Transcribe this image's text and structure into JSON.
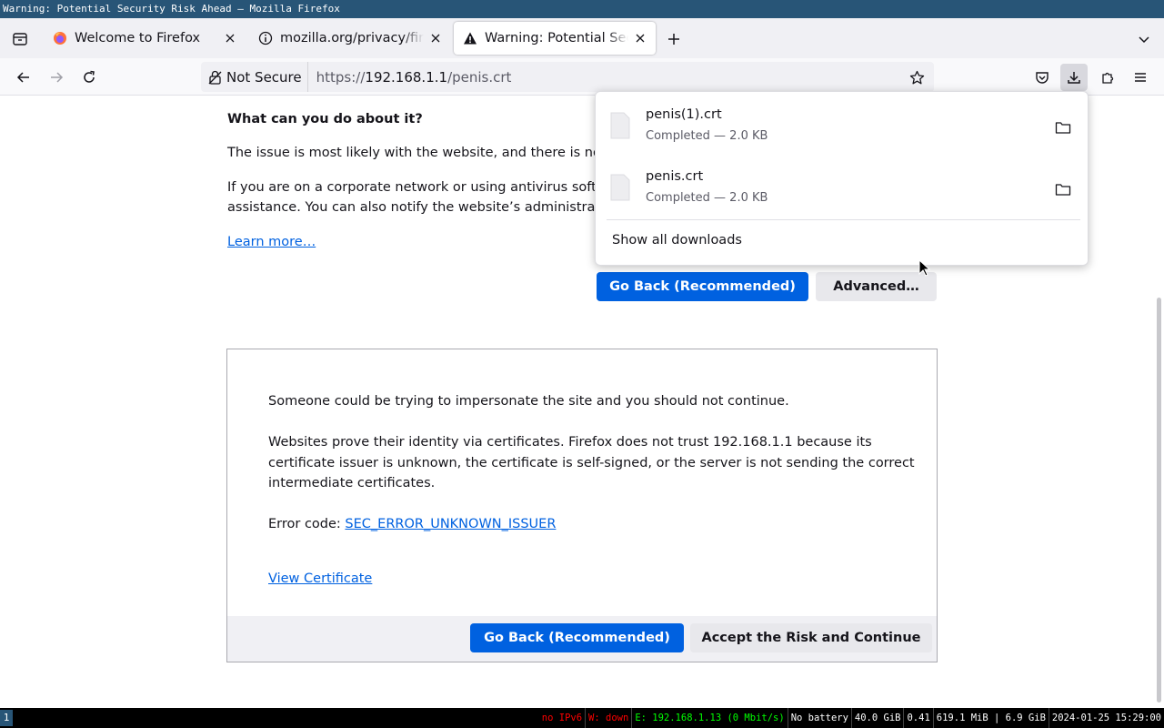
{
  "window": {
    "title": "Warning: Potential Security Risk Ahead — Mozilla Firefox"
  },
  "tabs": [
    {
      "label": "Welcome to Firefox",
      "icon": "firefox-logo-icon"
    },
    {
      "label": "mozilla.org/privacy/firefox",
      "icon": "info-icon"
    },
    {
      "label": "Warning: Potential Security Risk Ahead",
      "icon": "warning-icon",
      "selected": true
    }
  ],
  "navbar": {
    "identity_label": "Not Secure",
    "url_prefix": "https://",
    "url_host": "192.168.1.1",
    "url_path": "/penis.crt"
  },
  "content": {
    "heading": "What can you do about it?",
    "para1": "The issue is most likely with the website, and there is nothing you can do to resolve it.",
    "para2_line1": "If you are on a corporate network or using antivirus software, you can reach out to the support teams for",
    "para2_line2": "assistance. You can also notify the website’s administrator about the problem.",
    "learn_more": "Learn more…",
    "go_back_label": "Go Back (Recommended)",
    "advanced_label": "Advanced…"
  },
  "advanced": {
    "line1": "Someone could be trying to impersonate the site and you should not continue.",
    "line2a": "Websites prove their identity via certificates. Firefox does not trust 192.168.1.1 because its",
    "line2b": "certificate issuer is unknown, the certificate is self-signed, or the server is not sending the correct",
    "line2c": "intermediate certificates.",
    "error_code_label": "Error code: ",
    "error_code": "SEC_ERROR_UNKNOWN_ISSUER",
    "view_certificate": "View Certificate",
    "go_back_label": "Go Back (Recommended)",
    "accept_label": "Accept the Risk and Continue"
  },
  "downloads": {
    "items": [
      {
        "name": "penis(1).crt",
        "status": "Completed — 2.0 KB"
      },
      {
        "name": "penis.crt",
        "status": "Completed — 2.0 KB"
      }
    ],
    "show_all": "Show all downloads"
  },
  "statusbar": {
    "workspace": "1",
    "blocks": [
      {
        "text": "no IPv6",
        "color": "#ff0000"
      },
      {
        "text": "W: down",
        "color": "#ff0000"
      },
      {
        "text": "E: 192.168.1.13 (0 Mbit/s)",
        "color": "#00ff00"
      },
      {
        "text": "No battery",
        "color": "#ffffff"
      },
      {
        "text": "40.0 GiB",
        "color": "#ffffff"
      },
      {
        "text": "0.41",
        "color": "#ffffff"
      },
      {
        "text": "619.1 MiB | 6.9 GiB",
        "color": "#ffffff"
      },
      {
        "text": "2024-01-25 15:29:00",
        "color": "#ffffff"
      }
    ]
  },
  "colors": {
    "accent": "#0061e0",
    "titlebar": "#285577"
  }
}
